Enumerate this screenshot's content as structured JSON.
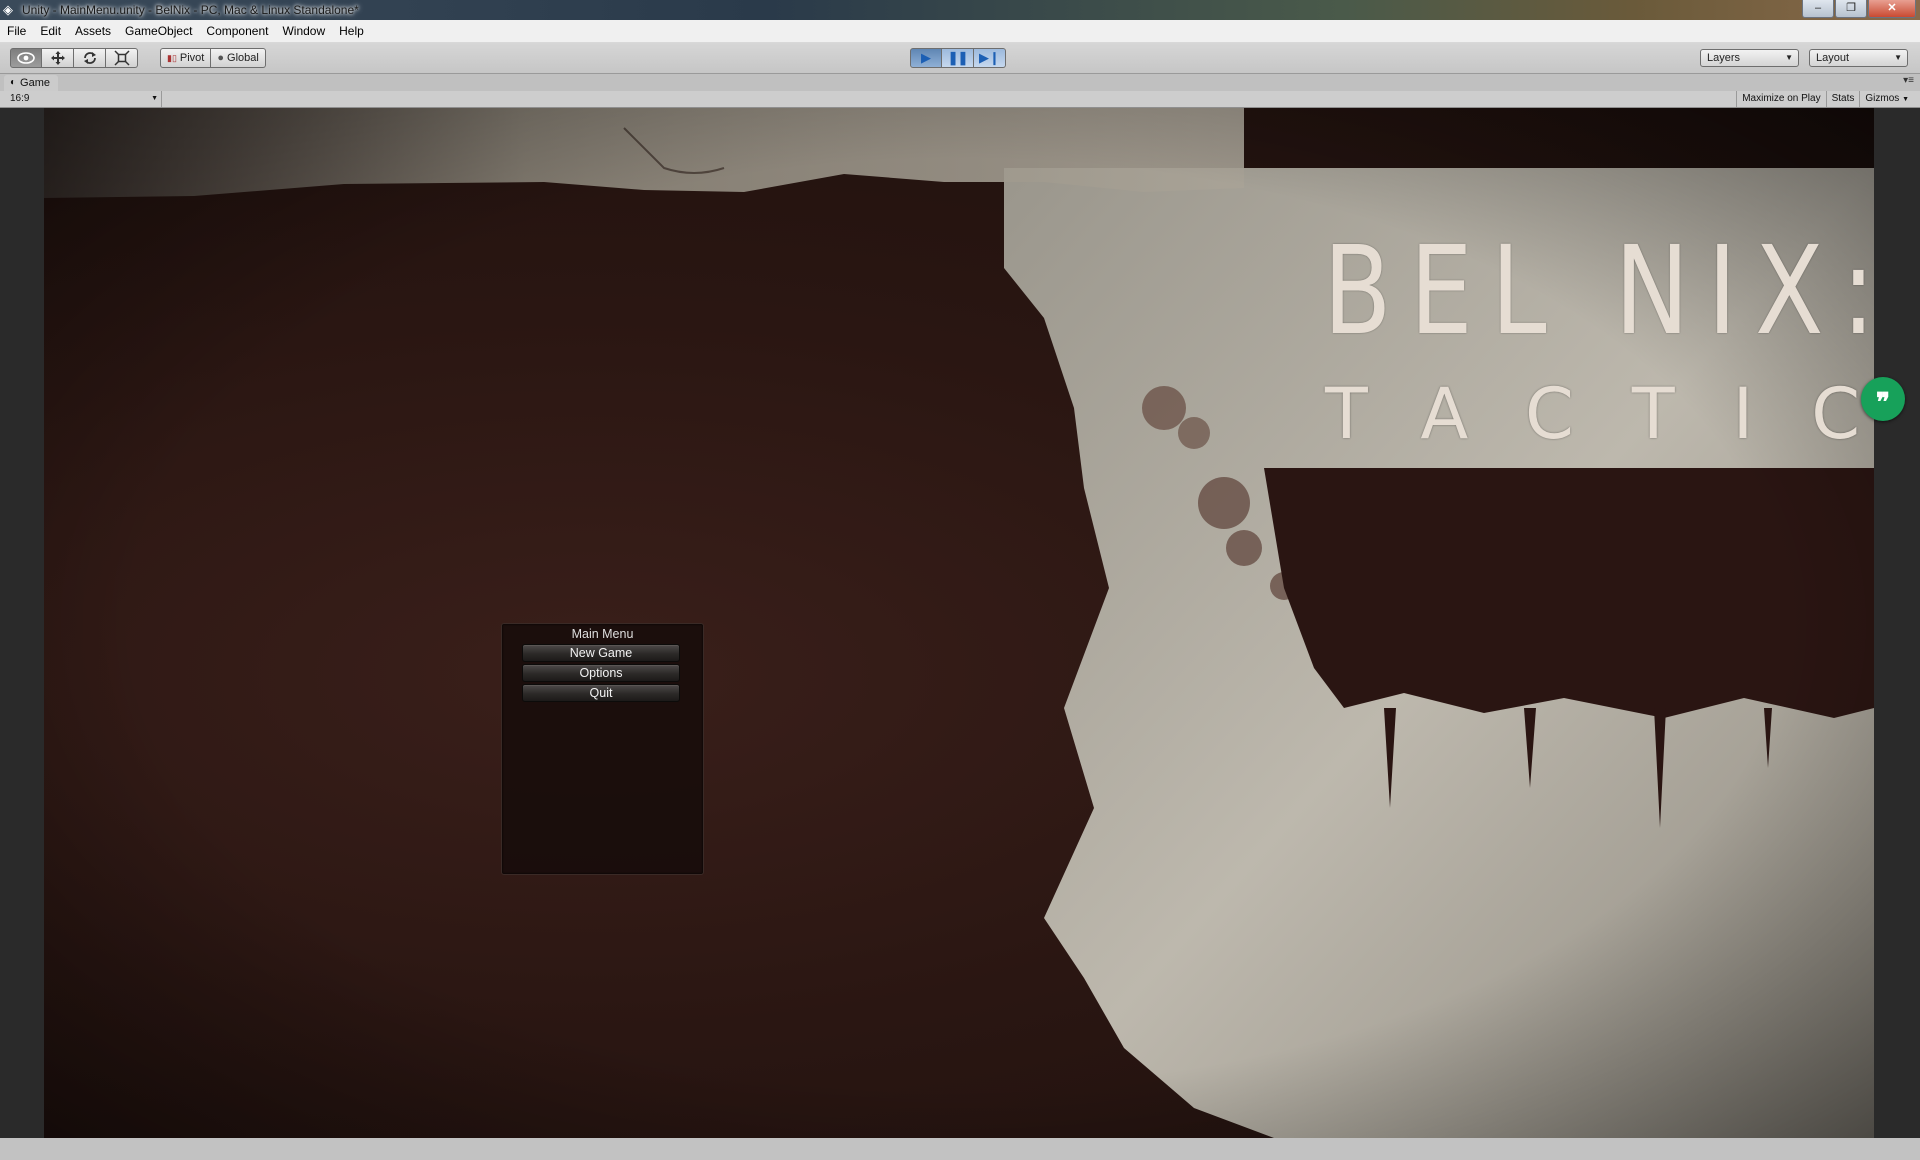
{
  "window": {
    "title": "Unity - MainMenu.unity - BelNix - PC, Mac & Linux Standalone*",
    "controls": [
      "–",
      "❐",
      "✕"
    ]
  },
  "menubar": {
    "items": [
      "File",
      "Edit",
      "Assets",
      "GameObject",
      "Component",
      "Window",
      "Help"
    ]
  },
  "toolbar": {
    "transform_tools": [
      "view-tool",
      "move-tool",
      "rotate-tool",
      "scale-tool"
    ],
    "pivot_label": "Pivot",
    "global_label": "Global",
    "layers_label": "Layers",
    "layout_label": "Layout",
    "play_state": "playing"
  },
  "panel": {
    "tab_label": "Game",
    "aspect_label": "16:9",
    "maximize_label": "Maximize on Play",
    "stats_label": "Stats",
    "gizmos_label": "Gizmos"
  },
  "game": {
    "logo_title": "BEL NIX:",
    "logo_subtitle": "TACTICS",
    "menu": {
      "title": "Main Menu",
      "buttons": [
        "New Game",
        "Options",
        "Quit"
      ]
    }
  },
  "colors": {
    "overlay_accent": "#17a15a",
    "play_blue": "#1c5fb4"
  }
}
